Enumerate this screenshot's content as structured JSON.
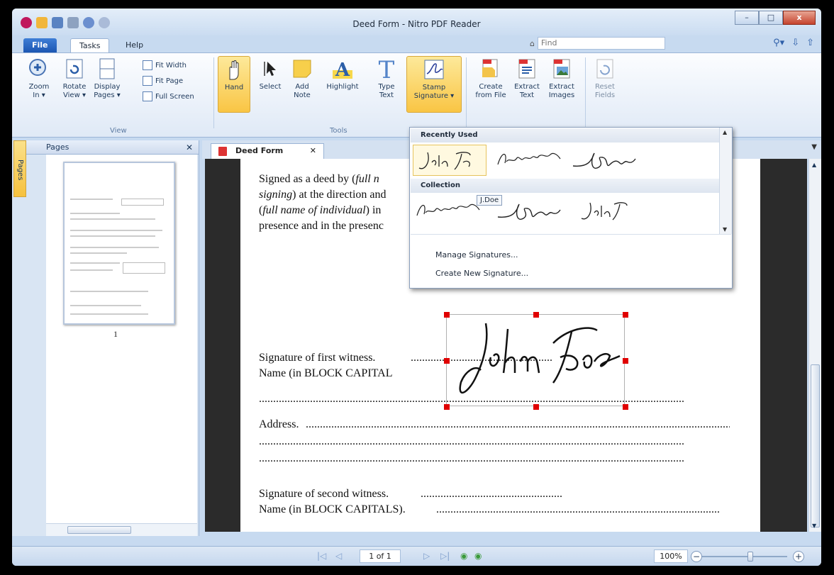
{
  "window": {
    "title": "Deed Form - Nitro PDF Reader",
    "min": "–",
    "max": "□",
    "close": "x"
  },
  "ribbon_tabs": {
    "file": "File",
    "tasks": "Tasks",
    "help": "Help"
  },
  "find": {
    "placeholder": "Find"
  },
  "ribbon": {
    "view_group": "View",
    "tools_group": "Tools",
    "zoom_in": "Zoom\nIn ▾",
    "rotate_view": "Rotate\nView ▾",
    "display_pages": "Display\nPages ▾",
    "fit_width": "Fit Width",
    "fit_page": "Fit Page",
    "full_screen": "Full Screen",
    "hand": "Hand",
    "select": "Select",
    "add_note": "Add\nNote",
    "highlight": "Highlight",
    "type_text": "Type\nText",
    "stamp_signature": "Stamp\nSignature ▾",
    "create_from_file": "Create\nfrom File",
    "extract_text": "Extract\nText",
    "extract_images": "Extract\nImages",
    "reset_fields": "Reset\nFields"
  },
  "pages_panel": {
    "title": "Pages",
    "vtab": "Pages",
    "page_number": "1"
  },
  "doc_tab": {
    "label": "Deed Form"
  },
  "document": {
    "p1a": "Signed as a deed by (",
    "p1b": "full n",
    "p2a": "signing",
    "p2b": ") at the direction and",
    "p3a": "(",
    "p3b": "full name of individual",
    "p3c": ") in",
    "p4": "presence and in the presenc",
    "witness1": "Signature of first witness.",
    "name1": "Name (in BLOCK CAPITAL",
    "address": "Address.",
    "witness2": "Signature of second witness.",
    "name2": "Name (in BLOCK CAPITALS)."
  },
  "dropdown": {
    "recent_header": "Recently Used",
    "collection_header": "Collection",
    "tooltip": "J.Doe",
    "manage": "Manage Signatures...",
    "create": "Create New Signature..."
  },
  "status": {
    "page": "1 of 1",
    "zoom": "100%"
  },
  "icons": [
    "zoom-in-icon",
    "rotate-icon",
    "display-pages-icon",
    "hand-icon",
    "select-icon",
    "note-icon",
    "highlight-icon",
    "type-text-icon",
    "stamp-signature-icon",
    "create-from-file-icon",
    "extract-text-icon",
    "extract-images-icon",
    "reset-fields-icon"
  ],
  "colors": {
    "accent": "#f9c544",
    "handle": "#e00000",
    "file_tab": "#1c56b2"
  }
}
